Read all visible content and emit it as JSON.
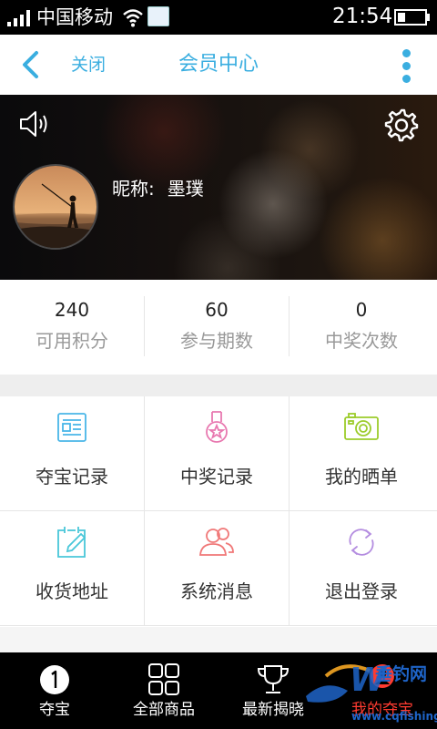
{
  "status_bar": {
    "carrier": "中国移动",
    "time": "21:54"
  },
  "nav": {
    "close_label": "关闭",
    "title": "会员中心"
  },
  "profile": {
    "nickname_label": "昵称:",
    "nickname": "墨璞"
  },
  "stats": [
    {
      "value": "240",
      "label": "可用积分"
    },
    {
      "value": "60",
      "label": "参与期数"
    },
    {
      "value": "0",
      "label": "中奖次数"
    }
  ],
  "menu": [
    {
      "label": "夺宝记录",
      "icon": "document-icon",
      "color": "#49b6e8"
    },
    {
      "label": "中奖记录",
      "icon": "medal-icon",
      "color": "#e879b0"
    },
    {
      "label": "我的晒单",
      "icon": "camera-icon",
      "color": "#9ccc2b"
    },
    {
      "label": "收货地址",
      "icon": "edit-calendar-icon",
      "color": "#49c7d9"
    },
    {
      "label": "系统消息",
      "icon": "users-icon",
      "color": "#f07878"
    },
    {
      "label": "退出登录",
      "icon": "refresh-icon",
      "color": "#b48de0"
    }
  ],
  "tabs": [
    {
      "label": "夺宝",
      "icon": "number-one-icon"
    },
    {
      "label": "全部商品",
      "icon": "grid-icon"
    },
    {
      "label": "最新揭晓",
      "icon": "trophy-icon"
    },
    {
      "label": "我的夺宝",
      "icon": "profile-icon"
    }
  ],
  "watermark": {
    "brand": "垂钓网",
    "url": "www.cqfishing.net"
  },
  "colors": {
    "accent": "#3aaee0",
    "active_tab": "#ff3b30"
  }
}
